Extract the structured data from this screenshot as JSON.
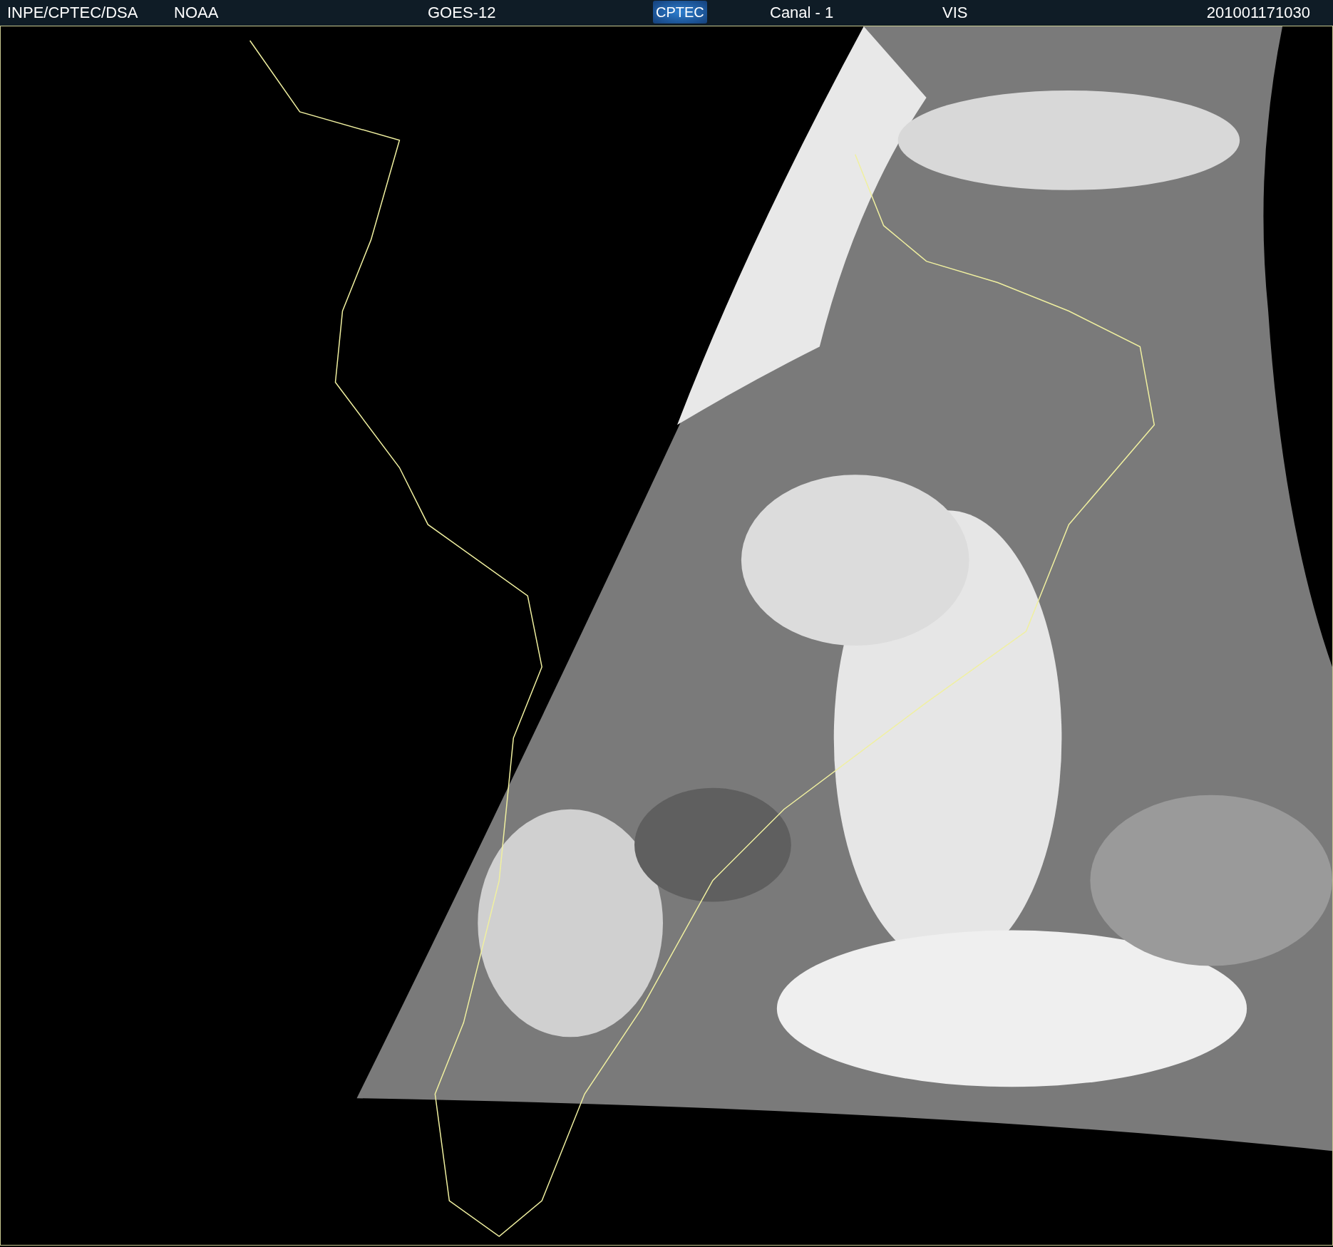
{
  "header": {
    "left_labels": [
      "INPE/CPTEC/DSA",
      "NOAA",
      "GOES-12"
    ],
    "logo": "CPTEC",
    "right_labels": [
      "Canal - 1",
      "VIS",
      "201001171030"
    ]
  }
}
